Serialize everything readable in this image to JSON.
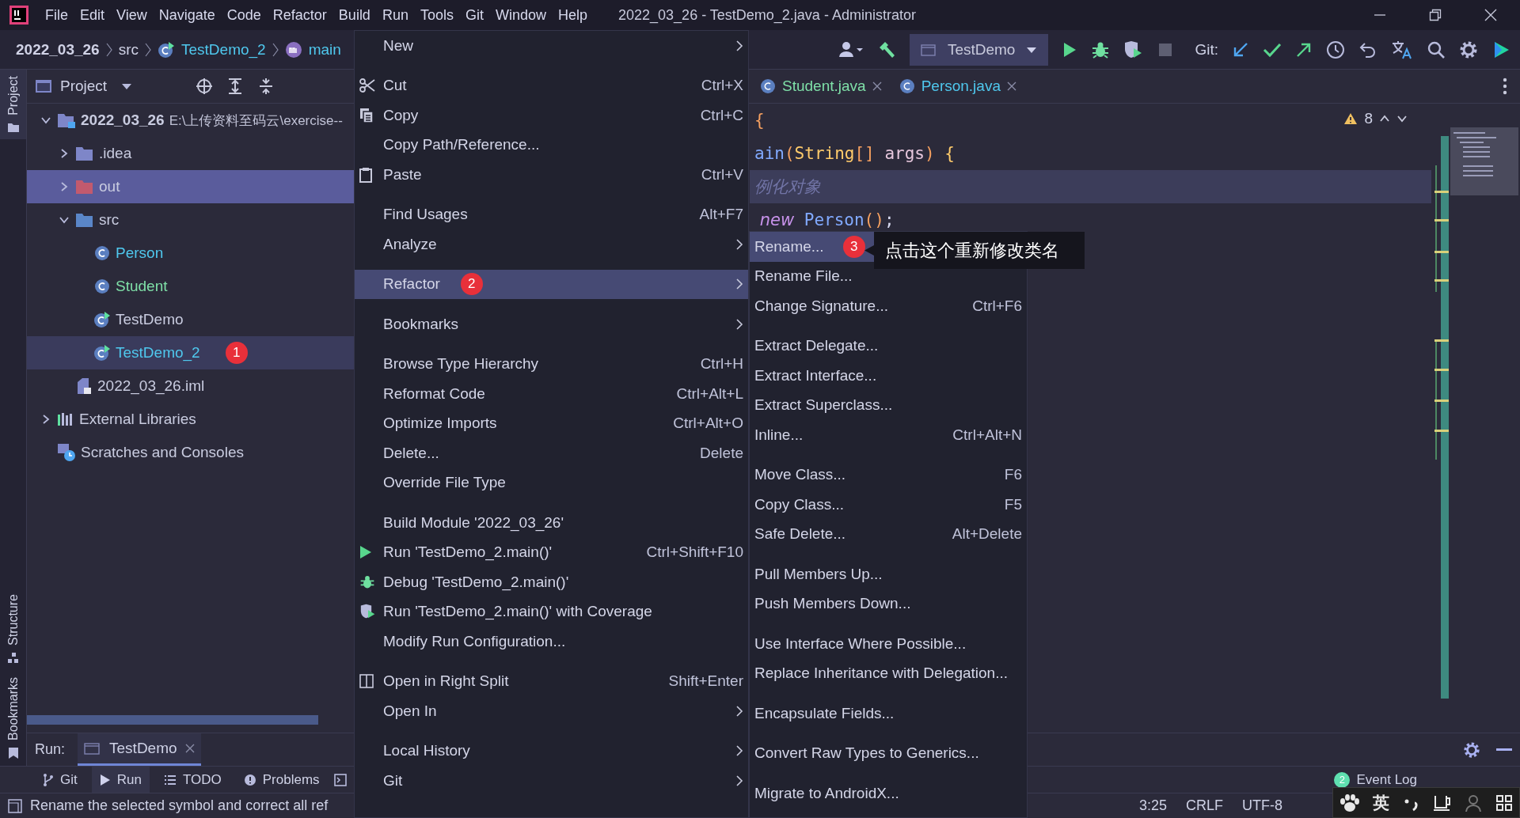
{
  "title_bar": {
    "menu": [
      "File",
      "Edit",
      "View",
      "Navigate",
      "Code",
      "Refactor",
      "Build",
      "Run",
      "Tools",
      "Git",
      "Window",
      "Help"
    ],
    "title": "2022_03_26 - TestDemo_2.java - Administrator"
  },
  "breadcrumbs": [
    {
      "label": "2022_03_26",
      "kind": "project"
    },
    {
      "label": "src",
      "kind": "folder"
    },
    {
      "label": "TestDemo_2",
      "kind": "class"
    },
    {
      "label": "main",
      "kind": "method"
    }
  ],
  "toolbar": {
    "run_config": "TestDemo",
    "git_label": "Git:"
  },
  "stripe": {
    "top": [
      {
        "label": "Project",
        "selected": true
      }
    ],
    "bottom": [
      {
        "label": "Structure",
        "selected": false
      },
      {
        "label": "Bookmarks",
        "selected": false
      }
    ]
  },
  "project_panel": {
    "title": "Project",
    "tree": [
      {
        "label": "2022_03_26",
        "kind": "module",
        "note": "E:\\上传资料至码云\\exercise--",
        "expanded": true,
        "selected": false,
        "current": false,
        "children": [
          {
            "label": ".idea",
            "kind": "folder",
            "expanded": false,
            "selected": false,
            "current": false
          },
          {
            "label": "out",
            "kind": "excluded-folder",
            "expanded": false,
            "selected": true,
            "current": false
          },
          {
            "label": "src",
            "kind": "source-folder",
            "expanded": true,
            "selected": false,
            "current": false,
            "children": [
              {
                "label": "Person",
                "kind": "class",
                "color": "#4fc8ee",
                "selected": false,
                "current": false
              },
              {
                "label": "Student",
                "kind": "class",
                "color": "#7fe0a8",
                "selected": false,
                "current": false
              },
              {
                "label": "TestDemo",
                "kind": "runnable-class",
                "color": "#c9cce0",
                "selected": false,
                "current": false
              },
              {
                "label": "TestDemo_2",
                "kind": "runnable-class",
                "color": "#4fc8ee",
                "selected": false,
                "current": true,
                "badge": "1"
              }
            ]
          },
          {
            "label": "2022_03_26.iml",
            "kind": "iml-file",
            "selected": false,
            "current": false
          }
        ]
      },
      {
        "label": "External Libraries",
        "kind": "libraries",
        "expanded": false,
        "selected": false,
        "current": false
      },
      {
        "label": "Scratches and Consoles",
        "kind": "scratches",
        "selected": false,
        "current": false
      }
    ]
  },
  "editor": {
    "tabs": [
      {
        "label": "Student.java",
        "color": "#7fe0a8",
        "selected": false
      },
      {
        "label": "Person.java",
        "color": "#4fc8ee",
        "selected": false
      }
    ],
    "warning_count": "8",
    "lines": [
      {
        "current": false,
        "tokens": [
          {
            "text": "{",
            "kind": "punct"
          }
        ]
      },
      {
        "current": false,
        "tokens": [
          {
            "text": "ain",
            "kind": "function"
          },
          {
            "text": "(",
            "kind": "punct"
          },
          {
            "text": "String",
            "kind": "type"
          },
          {
            "text": "[]",
            "kind": "punct"
          },
          {
            "text": " args",
            "kind": "param"
          },
          {
            "text": ")",
            "kind": "punct"
          },
          {
            "text": " {",
            "kind": "brace"
          }
        ]
      },
      {
        "current": true,
        "tokens": [
          {
            "text": "例化对象",
            "kind": "comment"
          }
        ]
      },
      {
        "current": false,
        "tokens": [
          {
            "text": " new",
            "kind": "keyword"
          },
          {
            "text": " Person",
            "kind": "function"
          },
          {
            "text": "()",
            "kind": "punct"
          },
          {
            "text": ";",
            "kind": "plain"
          }
        ]
      }
    ]
  },
  "context_menu": {
    "groups": [
      [
        {
          "label": "New",
          "submenu": true,
          "selected": false
        }
      ],
      [
        {
          "label": "Cut",
          "kind": "cut",
          "shortcut": "Ctrl+X",
          "selected": false
        },
        {
          "label": "Copy",
          "kind": "copy",
          "shortcut": "Ctrl+C",
          "selected": false
        },
        {
          "label": "Copy Path/Reference...",
          "selected": false
        },
        {
          "label": "Paste",
          "kind": "paste",
          "shortcut": "Ctrl+V",
          "selected": false
        }
      ],
      [
        {
          "label": "Find Usages",
          "shortcut": "Alt+F7",
          "selected": false
        },
        {
          "label": "Analyze",
          "submenu": true,
          "selected": false
        }
      ],
      [
        {
          "label": "Refactor",
          "submenu": true,
          "selected": true,
          "badge": "2"
        }
      ],
      [
        {
          "label": "Bookmarks",
          "submenu": true,
          "selected": false
        }
      ],
      [
        {
          "label": "Browse Type Hierarchy",
          "shortcut": "Ctrl+H",
          "selected": false
        },
        {
          "label": "Reformat Code",
          "shortcut": "Ctrl+Alt+L",
          "selected": false
        },
        {
          "label": "Optimize Imports",
          "shortcut": "Ctrl+Alt+O",
          "selected": false
        },
        {
          "label": "Delete...",
          "shortcut": "Delete",
          "selected": false
        },
        {
          "label": "Override File Type",
          "selected": false
        }
      ],
      [
        {
          "label": "Build Module '2022_03_26'",
          "selected": false
        },
        {
          "label": "Run 'TestDemo_2.main()'",
          "kind": "run",
          "shortcut": "Ctrl+Shift+F10",
          "selected": false
        },
        {
          "label": "Debug 'TestDemo_2.main()'",
          "kind": "debug",
          "selected": false
        },
        {
          "label": "Run 'TestDemo_2.main()' with Coverage",
          "kind": "coverage",
          "selected": false
        },
        {
          "label": "Modify Run Configuration...",
          "selected": false
        }
      ],
      [
        {
          "label": "Open in Right Split",
          "kind": "split",
          "shortcut": "Shift+Enter",
          "selected": false
        },
        {
          "label": "Open In",
          "submenu": true,
          "selected": false
        }
      ],
      [
        {
          "label": "Local History",
          "submenu": true,
          "selected": false
        },
        {
          "label": "Git",
          "submenu": true,
          "selected": false
        }
      ]
    ]
  },
  "refactor_menu": {
    "groups": [
      [
        {
          "label": "Rename...",
          "selected": true,
          "badge": "3"
        },
        {
          "label": "Rename File...",
          "selected": false
        },
        {
          "label": "Change Signature...",
          "shortcut": "Ctrl+F6",
          "selected": false
        }
      ],
      [
        {
          "label": "Extract Delegate...",
          "selected": false
        },
        {
          "label": "Extract Interface...",
          "selected": false
        },
        {
          "label": "Extract Superclass...",
          "selected": false
        },
        {
          "label": "Inline...",
          "shortcut": "Ctrl+Alt+N",
          "selected": false
        }
      ],
      [
        {
          "label": "Move Class...",
          "shortcut": "F6",
          "selected": false
        },
        {
          "label": "Copy Class...",
          "shortcut": "F5",
          "selected": false
        },
        {
          "label": "Safe Delete...",
          "shortcut": "Alt+Delete",
          "selected": false
        }
      ],
      [
        {
          "label": "Pull Members Up...",
          "selected": false
        },
        {
          "label": "Push Members Down...",
          "selected": false
        }
      ],
      [
        {
          "label": "Use Interface Where Possible...",
          "selected": false
        },
        {
          "label": "Replace Inheritance with Delegation...",
          "selected": false
        }
      ],
      [
        {
          "label": "Encapsulate Fields...",
          "selected": false
        }
      ],
      [
        {
          "label": "Convert Raw Types to Generics...",
          "selected": false
        }
      ],
      [
        {
          "label": "Migrate to AndroidX...",
          "selected": false
        }
      ]
    ]
  },
  "tooltip": {
    "text": "点击这个重新修改类名"
  },
  "run_panel": {
    "label": "Run:",
    "tab": "TestDemo"
  },
  "tool_tabs": [
    {
      "label": "Git",
      "kind": "git",
      "selected": false
    },
    {
      "label": "Run",
      "kind": "run",
      "selected": true
    },
    {
      "label": "TODO",
      "kind": "list",
      "selected": false
    },
    {
      "label": "Problems",
      "kind": "info",
      "selected": false
    }
  ],
  "event_log": {
    "count": "2",
    "label": "Event Log"
  },
  "status_bar": {
    "message": "Rename the selected symbol and correct all ref",
    "position": "3:25",
    "line_separator": "CRLF",
    "encoding": "UTF-8"
  },
  "ime_toolbar": {
    "mode": "英"
  }
}
